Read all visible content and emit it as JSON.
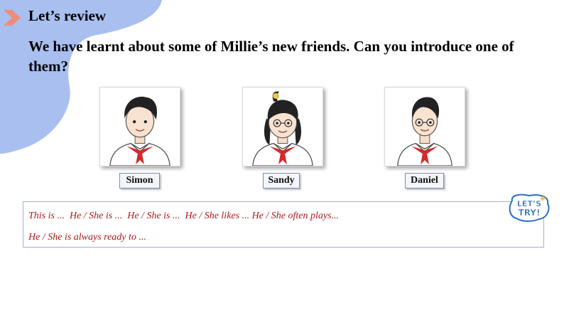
{
  "header": {
    "section_title": "Let’s review",
    "prompt": "We have learnt about some of Millie’s new friends. Can you introduce one of them?"
  },
  "friends": [
    {
      "name": "Simon"
    },
    {
      "name": "Sandy"
    },
    {
      "name": "Daniel"
    }
  ],
  "sentence_patterns": {
    "line1": "This is ...  He / She is ...  He / She is ...  He / She likes ... He / She often plays...",
    "line2": "He / She is always ready to ..."
  },
  "badge": {
    "text": "LET’S TRY!"
  },
  "colors": {
    "blob": "#a9bff0",
    "accent_arrow": "#f08c7a",
    "sentence_text": "#b31a1a",
    "box_border": "#9fb2d9"
  }
}
